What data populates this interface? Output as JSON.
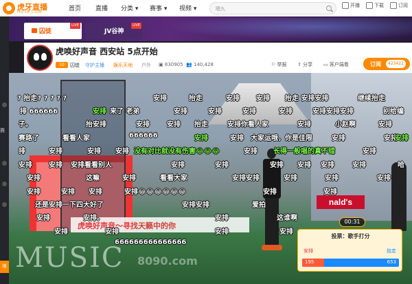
{
  "brand": {
    "name": "虎牙直播",
    "sub": "HUYA.COM"
  },
  "nav": [
    "首页",
    "直播",
    "分类 ▾",
    "赛事 ▾",
    "视频 ▾"
  ],
  "search": {
    "value": "嗯九"
  },
  "tools": [
    {
      "icon": "broadcast-icon",
      "label": "开播"
    },
    {
      "icon": "download-icon",
      "label": "下载"
    },
    {
      "icon": "subscribe-icon",
      "label": "订阅"
    }
  ],
  "side": {
    "items": [
      "赛",
      "播"
    ]
  },
  "tabs": [
    {
      "label": "囚徒",
      "badge": "LIVE"
    },
    {
      "label": "JV谷神",
      "badge": "LIVE"
    }
  ],
  "room": {
    "title": "虎唤好声音 西安站 5点开始",
    "level": "10",
    "host": "囚徒",
    "host_tag": "守护主播",
    "category": "娱乐天地",
    "sub_category": "户外",
    "room_id": "830905",
    "viewers": "140,428",
    "actions": [
      "举报",
      "分享",
      "客户端看"
    ],
    "subscribe_label": "订阅",
    "subscribe_count": "423422"
  },
  "danmaku": [
    {
      "text": "? 抬走? ? ? ? ?",
      "green": false
    },
    {
      "text": "安排",
      "green": false
    },
    {
      "text": "抬走",
      "green": false
    },
    {
      "text": "安排",
      "green": false
    },
    {
      "text": "安排",
      "green": false
    },
    {
      "text": "抬走 安排安排",
      "green": false
    },
    {
      "text": "继续抬走",
      "green": false
    },
    {
      "text": "排 666666",
      "green": false
    },
    {
      "text": "安排",
      "green": true
    },
    {
      "text": "来了 老弟",
      "green": false
    },
    {
      "text": "安排",
      "green": false
    },
    {
      "text": "安排",
      "green": false
    },
    {
      "text": "安排",
      "green": false
    },
    {
      "text": "安排",
      "green": false
    },
    {
      "text": "安排安排安排",
      "green": false
    },
    {
      "text": "别给编",
      "green": false
    },
    {
      "text": "子。",
      "green": false
    },
    {
      "text": "抬安排",
      "green": false
    },
    {
      "text": "安排",
      "green": false
    },
    {
      "text": "安排",
      "green": false
    },
    {
      "text": "抬走",
      "green": false
    },
    {
      "text": "安排你看人家",
      "green": false
    },
    {
      "text": "安排",
      "green": false
    },
    {
      "text": "小赵啊",
      "green": false
    },
    {
      "text": "安排",
      "green": false
    },
    {
      "text": "赛路了",
      "green": false
    },
    {
      "text": "看看人家",
      "green": false
    },
    {
      "text": "666666",
      "green": false
    },
    {
      "text": "安排",
      "green": true
    },
    {
      "text": "安排",
      "green": false
    },
    {
      "text": "大家运哦，你是佳限",
      "green": false
    },
    {
      "text": "安排",
      "green": false
    },
    {
      "text": "安排",
      "green": false
    },
    {
      "text": "排",
      "green": false
    },
    {
      "text": "安排",
      "green": false
    },
    {
      "text": "安排",
      "green": false
    },
    {
      "text": "安排",
      "green": false
    },
    {
      "text": "没有对比就没有伤害😂😂😂",
      "green": true
    },
    {
      "text": "安排",
      "green": false
    },
    {
      "text": "长得一般唱的真不错",
      "green": true
    },
    {
      "text": "安排",
      "green": false
    },
    {
      "text": "安排",
      "green": true
    },
    {
      "text": "安排",
      "green": false
    },
    {
      "text": "安排",
      "green": false
    },
    {
      "text": "安排看看别人",
      "green": false
    },
    {
      "text": "安排",
      "green": false
    },
    {
      "text": "安排",
      "green": false
    },
    {
      "text": "安排",
      "green": false
    },
    {
      "text": "安排",
      "green": false
    },
    {
      "text": "安排",
      "green": false
    },
    {
      "text": "安排",
      "green": false
    },
    {
      "text": "哈",
      "green": false
    },
    {
      "text": "安排",
      "green": false
    },
    {
      "text": "这嘛",
      "green": false
    },
    {
      "text": "安排",
      "green": false
    },
    {
      "text": "看看大家",
      "green": false
    },
    {
      "text": "安排安排",
      "green": false
    },
    {
      "text": "安排",
      "green": false
    },
    {
      "text": "安排",
      "green": false
    },
    {
      "text": "安排",
      "green": false
    },
    {
      "text": "安排",
      "green": false
    },
    {
      "text": "安排",
      "green": false
    },
    {
      "text": "安排",
      "green": false
    },
    {
      "text": "安排😂😂😂😂😂😂",
      "green": false
    },
    {
      "text": "安排",
      "green": false
    },
    {
      "text": "安排",
      "green": false
    },
    {
      "text": "还是安排一下四大好了",
      "green": false
    },
    {
      "text": "安排安排",
      "green": false
    },
    {
      "text": "爱拍",
      "green": false
    },
    {
      "text": "安排",
      "green": false
    },
    {
      "text": "安排。",
      "green": false
    },
    {
      "text": "安排",
      "green": false
    },
    {
      "text": "这谁啊",
      "green": false
    },
    {
      "text": "安排",
      "green": false
    },
    {
      "text": "安排",
      "green": false
    },
    {
      "text": "安排",
      "green": false
    },
    {
      "text": "安排",
      "green": false
    },
    {
      "text": "666666666666666",
      "green": false
    }
  ],
  "scene": {
    "banner_text": "虎唤好声音～寻找天籁中的你",
    "store_sign": "nald's"
  },
  "watermark": {
    "text": "MUSIC",
    "site": "8090.com"
  },
  "vote": {
    "timer": "00:31",
    "title": "投票：歌手打分",
    "option_left": "安排",
    "option_right": "抬走",
    "count_left": "195",
    "count_right": "653",
    "share_left": 0.23,
    "colors": {
      "left": "#ff5a3a",
      "right": "#1a8aff"
    }
  },
  "colors": {
    "accent": "#ff8a00",
    "danmaku_green": "#7cff4a",
    "live": "#e83a3a"
  }
}
